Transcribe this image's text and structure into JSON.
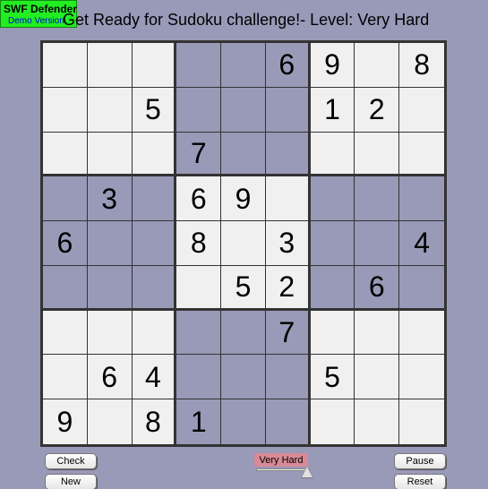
{
  "watermark": {
    "title": "SWF Defender",
    "subtitle": "Demo Version"
  },
  "header": {
    "title": "Get Ready for Sudoku challenge!- Level: Very Hard"
  },
  "board": {
    "rows": [
      [
        "",
        "",
        "",
        "",
        "",
        "6",
        "9",
        "",
        "8"
      ],
      [
        "",
        "",
        "5",
        "",
        "",
        "",
        "1",
        "2",
        ""
      ],
      [
        "",
        "",
        "",
        "7",
        "",
        "",
        "",
        "",
        ""
      ],
      [
        "",
        "3",
        "",
        "6",
        "9",
        "",
        "",
        "",
        ""
      ],
      [
        "6",
        "",
        "",
        "8",
        "",
        "3",
        "",
        "",
        "4"
      ],
      [
        "",
        "",
        "",
        "",
        "5",
        "2",
        "",
        "6",
        ""
      ],
      [
        "",
        "",
        "",
        "",
        "",
        "7",
        "",
        "",
        ""
      ],
      [
        "",
        "6",
        "4",
        "",
        "",
        "",
        "5",
        "",
        ""
      ],
      [
        "9",
        "",
        "8",
        "1",
        "",
        "",
        "",
        "",
        ""
      ]
    ],
    "colors": {
      "light_box": "#f0f0f0",
      "dark_box": "#9999b8",
      "grid_line": "#333333"
    }
  },
  "controls": {
    "check_label": "Check",
    "new_label": "New",
    "pause_label": "Pause",
    "reset_label": "Reset",
    "difficulty_label": "Very Hard",
    "difficulty_level_fraction": 1.0
  }
}
